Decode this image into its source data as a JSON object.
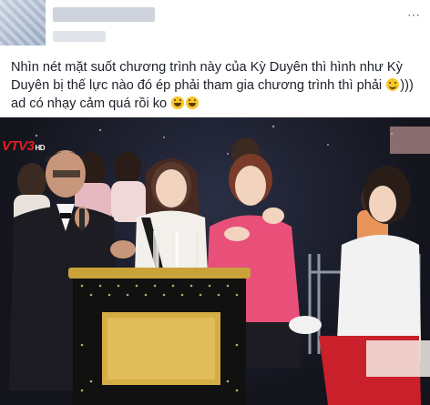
{
  "post": {
    "text_line1": "Nhìn nét mặt suốt chương trình này của Kỳ Duyên thì hình như Kỳ",
    "text_line2": "Duyên bị thế lực nào đó ép phải tham gia chương trình thì phải",
    "text_line2_suffix": ")))",
    "text_line3": "ad có nhạy cảm quá rồi ko",
    "emojis": [
      "smile-emoji",
      "laughing-emoji",
      "laughing-emoji"
    ]
  },
  "header": {
    "more_icon": "⋯"
  },
  "photo": {
    "logo_text": "VTV3",
    "logo_suffix": "HD",
    "colors": {
      "background": "#13141c",
      "table_gold": "#c9a33a",
      "pink_outfit": "#e8507a",
      "white_outfit": "#f2f2f2",
      "red_pants": "#c9202b"
    }
  }
}
